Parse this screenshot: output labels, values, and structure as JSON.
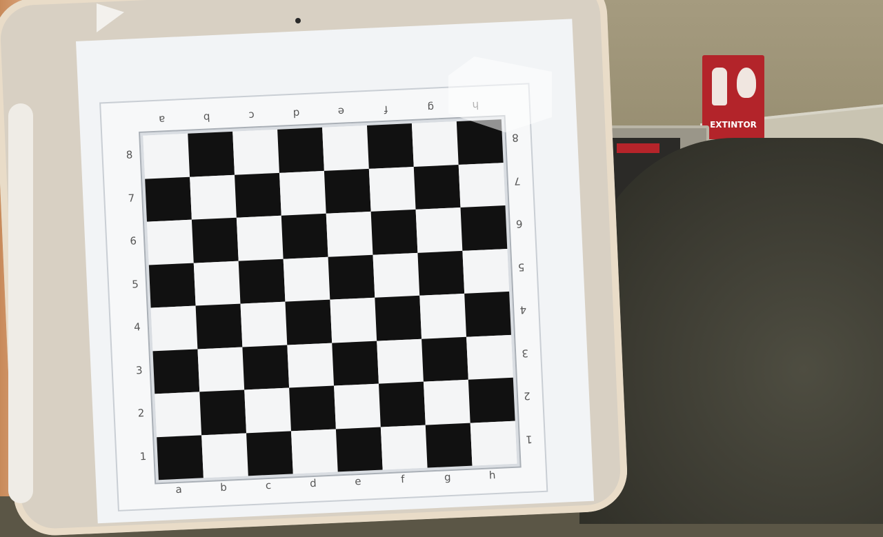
{
  "sign": {
    "label": "EXTINTOR"
  },
  "board": {
    "files": [
      "a",
      "b",
      "c",
      "d",
      "e",
      "f",
      "g",
      "h"
    ],
    "ranks": [
      "8",
      "7",
      "6",
      "5",
      "4",
      "3",
      "2",
      "1"
    ]
  },
  "colors": {
    "light_square": "#f4f5f6",
    "dark_square": "#111111",
    "sign_red": "#b3242a"
  }
}
